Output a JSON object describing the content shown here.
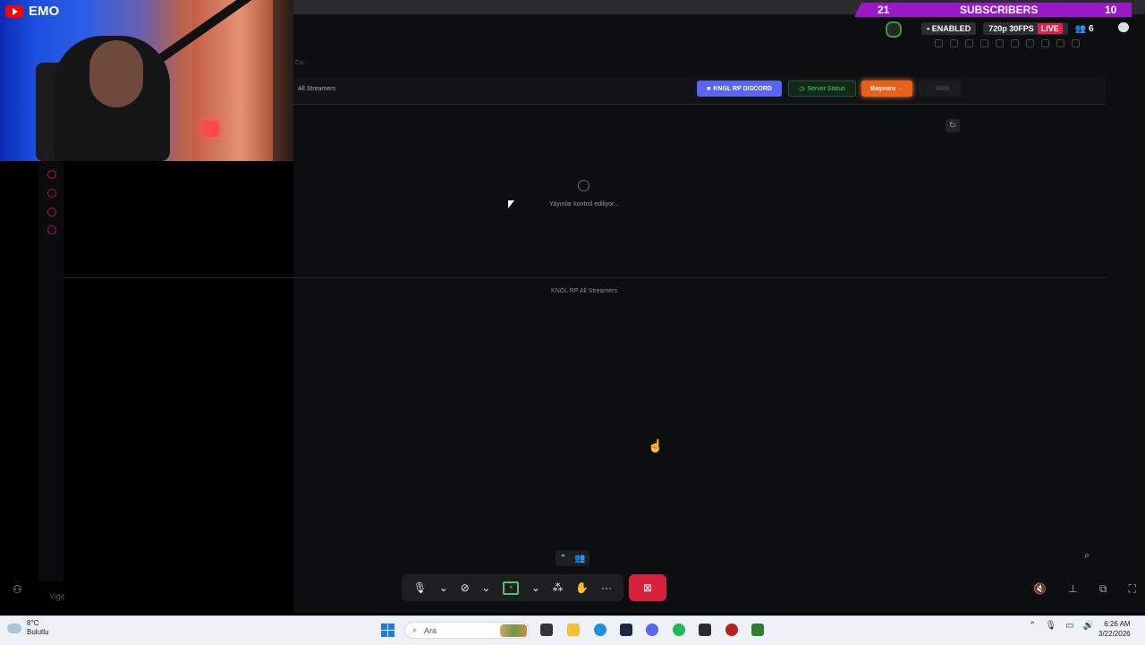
{
  "overlay": {
    "channel_name": "EMO",
    "subscribers_current": "21",
    "subscribers_label": "SUBSCRIBERS",
    "subscribers_goal": "10",
    "enabled_label": "ENABLED",
    "quality_label": "720p 30FPS",
    "live_label": "LIVE",
    "viewers": "6"
  },
  "page": {
    "breadcrumb": "Co...",
    "title": "All Streamers",
    "buttons": {
      "discord": "KNGL RP DISCORD",
      "server_status": "Server Status",
      "basvuru": "Başvuru →",
      "bildir": "Bildir"
    },
    "loading_text": "Yayınlar kontrol ediliyor...",
    "footer_text": "KNGL RP All Streamers"
  },
  "call": {
    "user_label": "Yiğit"
  },
  "taskbar": {
    "weather_temp": "8°C",
    "weather_desc": "Bulutlu",
    "search_placeholder": "Ara",
    "time": "6:26 AM",
    "date": "3/22/2026"
  },
  "colors": {
    "discord": "#5865f2",
    "basvuru": "#e8601c",
    "server_status": "#3dd56d",
    "subscribers_banner": "#9a18c8",
    "end_call": "#d8223c"
  }
}
